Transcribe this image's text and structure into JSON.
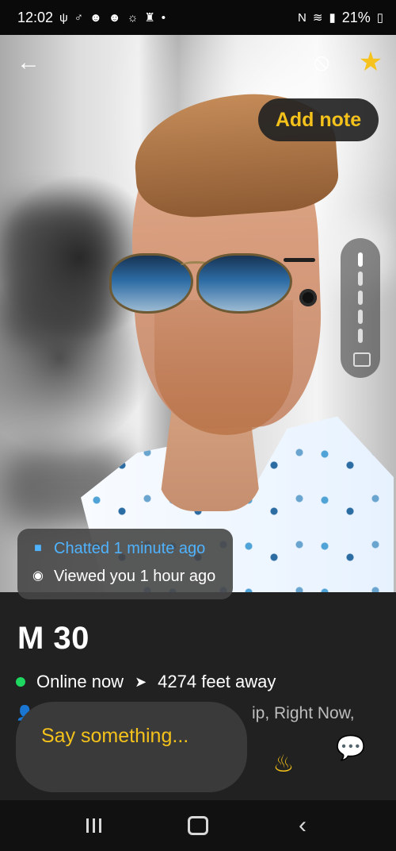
{
  "status": {
    "time": "12:02",
    "left_icons": [
      "usb-icon",
      "connections-icon",
      "notification-icon-1",
      "notification-icon-2",
      "alarm-icon",
      "trophy-icon",
      "dot-icon"
    ],
    "right_icons": [
      "nfc-icon",
      "wifi-icon",
      "signal-icon",
      "battery-icon"
    ],
    "battery": "21%"
  },
  "header": {
    "add_note": "Add note"
  },
  "activity": {
    "chatted": "Chatted 1 minute ago",
    "viewed": "Viewed you 1 hour ago"
  },
  "profile": {
    "title": "M 30",
    "online": "Online now",
    "distance": "4274 feet away",
    "partial_tags": "ip, Right Now,"
  },
  "message": {
    "placeholder": "Say something..."
  },
  "colors": {
    "accent": "#F4C21B",
    "online": "#1ED760"
  },
  "photo_progress": {
    "current": 1,
    "total": 6
  }
}
